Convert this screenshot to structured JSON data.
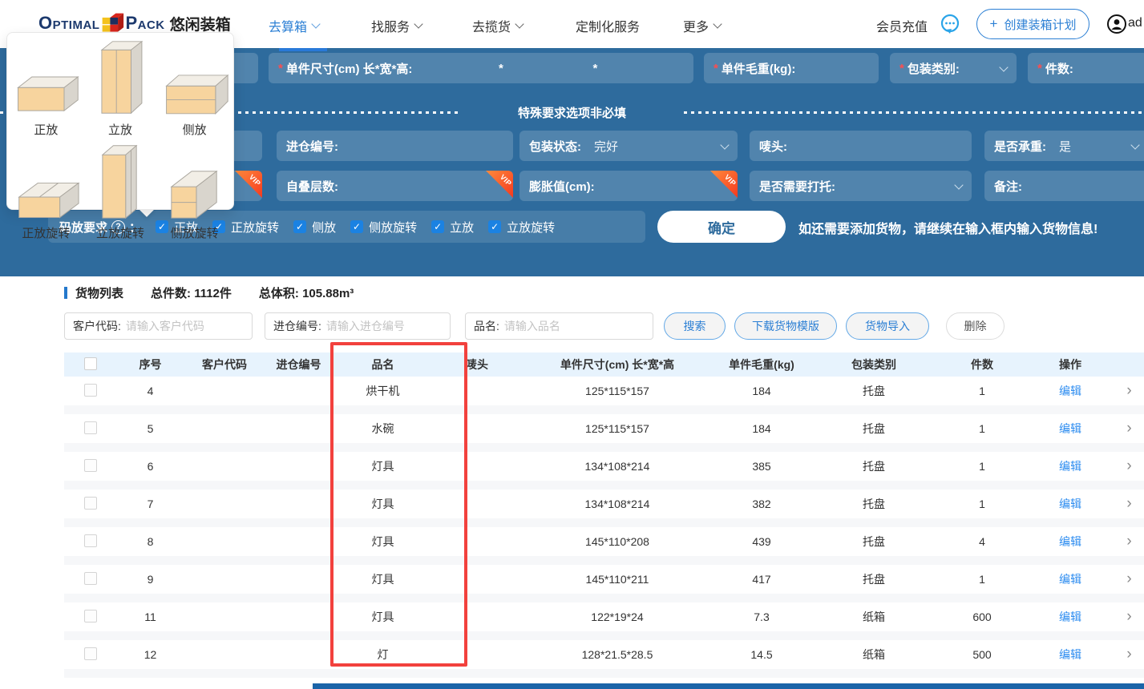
{
  "navbar": {
    "logo_optimal": "Optimal",
    "logo_pack": "Pack",
    "logo_suffix": "悠闲装箱",
    "items": [
      {
        "label": "去算箱"
      },
      {
        "label": "找服务"
      },
      {
        "label": "去揽货"
      },
      {
        "label": "定制化服务"
      },
      {
        "label": "更多"
      }
    ],
    "recharge_label": "会员充值",
    "create_plan_plus": "+",
    "create_plan_label": "创建装箱计划",
    "username": "ad"
  },
  "popup": {
    "options": [
      "正放",
      "立放",
      "侧放",
      "正放旋转",
      "立放旋转",
      "侧放旋转"
    ]
  },
  "form": {
    "size_label": "单件尺寸(cm) 长*宽*高:",
    "size_sep": "*",
    "weight_label": "单件毛重(kg):",
    "pkg_type_label": "包装类别:",
    "qty_label": "件数:",
    "divider_text": "特殊要求选项非必填",
    "warehouse_label": "进仓编号:",
    "pkg_status_label": "包装状态:",
    "pkg_status_value": "完好",
    "mark_label": "唛头:",
    "bearing_label": "是否承重:",
    "bearing_value": "是",
    "stack_layers_label": "自叠层数:",
    "expansion_label": "膨胀值(cm):",
    "pallet_label": "是否需要打托:",
    "remark_label": "备注:",
    "vip": "VIP",
    "stacking_label": "码放要求",
    "stacking_help": "?",
    "stacking_colon": "：",
    "stacking_options": [
      "正放",
      "正放旋转",
      "侧放",
      "侧放旋转",
      "立放",
      "立放旋转"
    ],
    "confirm_label": "确定",
    "hint": "如还需要添加货物，请继续在输入框内输入货物信息!"
  },
  "cargo": {
    "title": "货物列表",
    "total_count_label": "总件数:",
    "total_count_value": "1112件",
    "total_volume_label": "总体积:",
    "total_volume_value": "105.88m³",
    "search_customer_label": "客户代码:",
    "search_customer_placeholder": "请输入客户代码",
    "search_warehouse_label": "进仓编号:",
    "search_warehouse_placeholder": "请输入进仓编号",
    "search_name_label": "品名:",
    "search_name_placeholder": "请输入品名",
    "btn_search": "搜索",
    "btn_download": "下载货物模版",
    "btn_import": "货物导入",
    "btn_delete": "删除",
    "table": {
      "headers": [
        "序号",
        "客户代码",
        "进仓编号",
        "品名",
        "唛头",
        "单件尺寸(cm) 长*宽*高",
        "单件毛重(kg)",
        "包装类别",
        "件数",
        "操作"
      ],
      "edit_label": "编辑",
      "rows": [
        {
          "seq": "4",
          "customer": "",
          "warehouse": "",
          "name": "烘干机",
          "mark": "",
          "size": "125*115*157",
          "weight": "184",
          "pkg": "托盘",
          "qty": "1"
        },
        {
          "seq": "5",
          "customer": "",
          "warehouse": "",
          "name": "水碗",
          "mark": "",
          "size": "125*115*157",
          "weight": "184",
          "pkg": "托盘",
          "qty": "1"
        },
        {
          "seq": "6",
          "customer": "",
          "warehouse": "",
          "name": "灯具",
          "mark": "",
          "size": "134*108*214",
          "weight": "385",
          "pkg": "托盘",
          "qty": "1"
        },
        {
          "seq": "7",
          "customer": "",
          "warehouse": "",
          "name": "灯具",
          "mark": "",
          "size": "134*108*214",
          "weight": "382",
          "pkg": "托盘",
          "qty": "1"
        },
        {
          "seq": "8",
          "customer": "",
          "warehouse": "",
          "name": "灯具",
          "mark": "",
          "size": "145*110*208",
          "weight": "439",
          "pkg": "托盘",
          "qty": "4"
        },
        {
          "seq": "9",
          "customer": "",
          "warehouse": "",
          "name": "灯具",
          "mark": "",
          "size": "145*110*211",
          "weight": "417",
          "pkg": "托盘",
          "qty": "1"
        },
        {
          "seq": "11",
          "customer": "",
          "warehouse": "",
          "name": "灯具",
          "mark": "",
          "size": "122*19*24",
          "weight": "7.3",
          "pkg": "纸箱",
          "qty": "600"
        },
        {
          "seq": "12",
          "customer": "",
          "warehouse": "",
          "name": "灯",
          "mark": "",
          "size": "128*21.5*28.5",
          "weight": "14.5",
          "pkg": "纸箱",
          "qty": "500"
        }
      ]
    }
  },
  "colors": {
    "accent_blue": "#2b7fd4",
    "form_blue": "#2e6b9d",
    "highlight_red": "#f2413d",
    "link_blue": "#2c8cf0",
    "vip_orange": "#f5391f"
  }
}
